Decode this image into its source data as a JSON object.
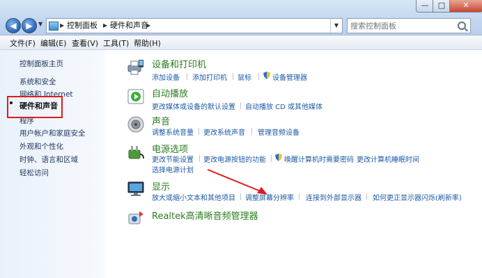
{
  "window": {
    "minimize": "—",
    "maximize": "□",
    "close": "✕"
  },
  "nav": {
    "back": "◀",
    "forward": "▶",
    "dropdown": "▼",
    "breadcrumb": [
      "控制面板",
      "硬件和声音"
    ],
    "breadcrumb_sep": "▶",
    "refresh": "⟳"
  },
  "search": {
    "placeholder": "搜索控制面板"
  },
  "menu": [
    "文件(F)",
    "编辑(E)",
    "查看(V)",
    "工具(T)",
    "帮助(H)"
  ],
  "sidebar": {
    "items": [
      "控制面板主页",
      "系统和安全",
      "网络和 Internet",
      "硬件和声音",
      "程序",
      "用户帐户和家庭安全",
      "外观和个性化",
      "时钟、语言和区域",
      "轻松访问"
    ],
    "active_index": 3
  },
  "categories": [
    {
      "title": "设备和打印机",
      "icon": "printer-icon",
      "links": [
        "添加设备",
        "添加打印机",
        "鼠标",
        "设备管理器"
      ]
    },
    {
      "title": "自动播放",
      "icon": "autoplay-icon",
      "links": [
        "更改媒体或设备的默认设置",
        "自动播放 CD 或其他媒体"
      ]
    },
    {
      "title": "声音",
      "icon": "speaker-icon",
      "links": [
        "调整系统音量",
        "更改系统声音",
        "管理音频设备"
      ]
    },
    {
      "title": "电源选项",
      "icon": "power-icon",
      "links": [
        "更改节能设置",
        "更改电源按钮的功能",
        "唤醒计算机时需要密码",
        "更改计算机睡眠时间",
        "选择电源计划"
      ]
    },
    {
      "title": "显示",
      "icon": "monitor-icon",
      "links": [
        "放大或缩小文本和其他项目",
        "调整屏幕分辨率",
        "连接到外部显示器",
        "如何更正显示器闪烁(刷新率)"
      ]
    },
    {
      "title": "Realtek高清晰音频管理器",
      "icon": "realtek-audio-icon",
      "links": []
    }
  ],
  "colors": {
    "category_title": "#2a7d1f",
    "link": "#1d5aa5",
    "highlight_box": "#e01b1b",
    "arrow": "#e01b1b"
  }
}
